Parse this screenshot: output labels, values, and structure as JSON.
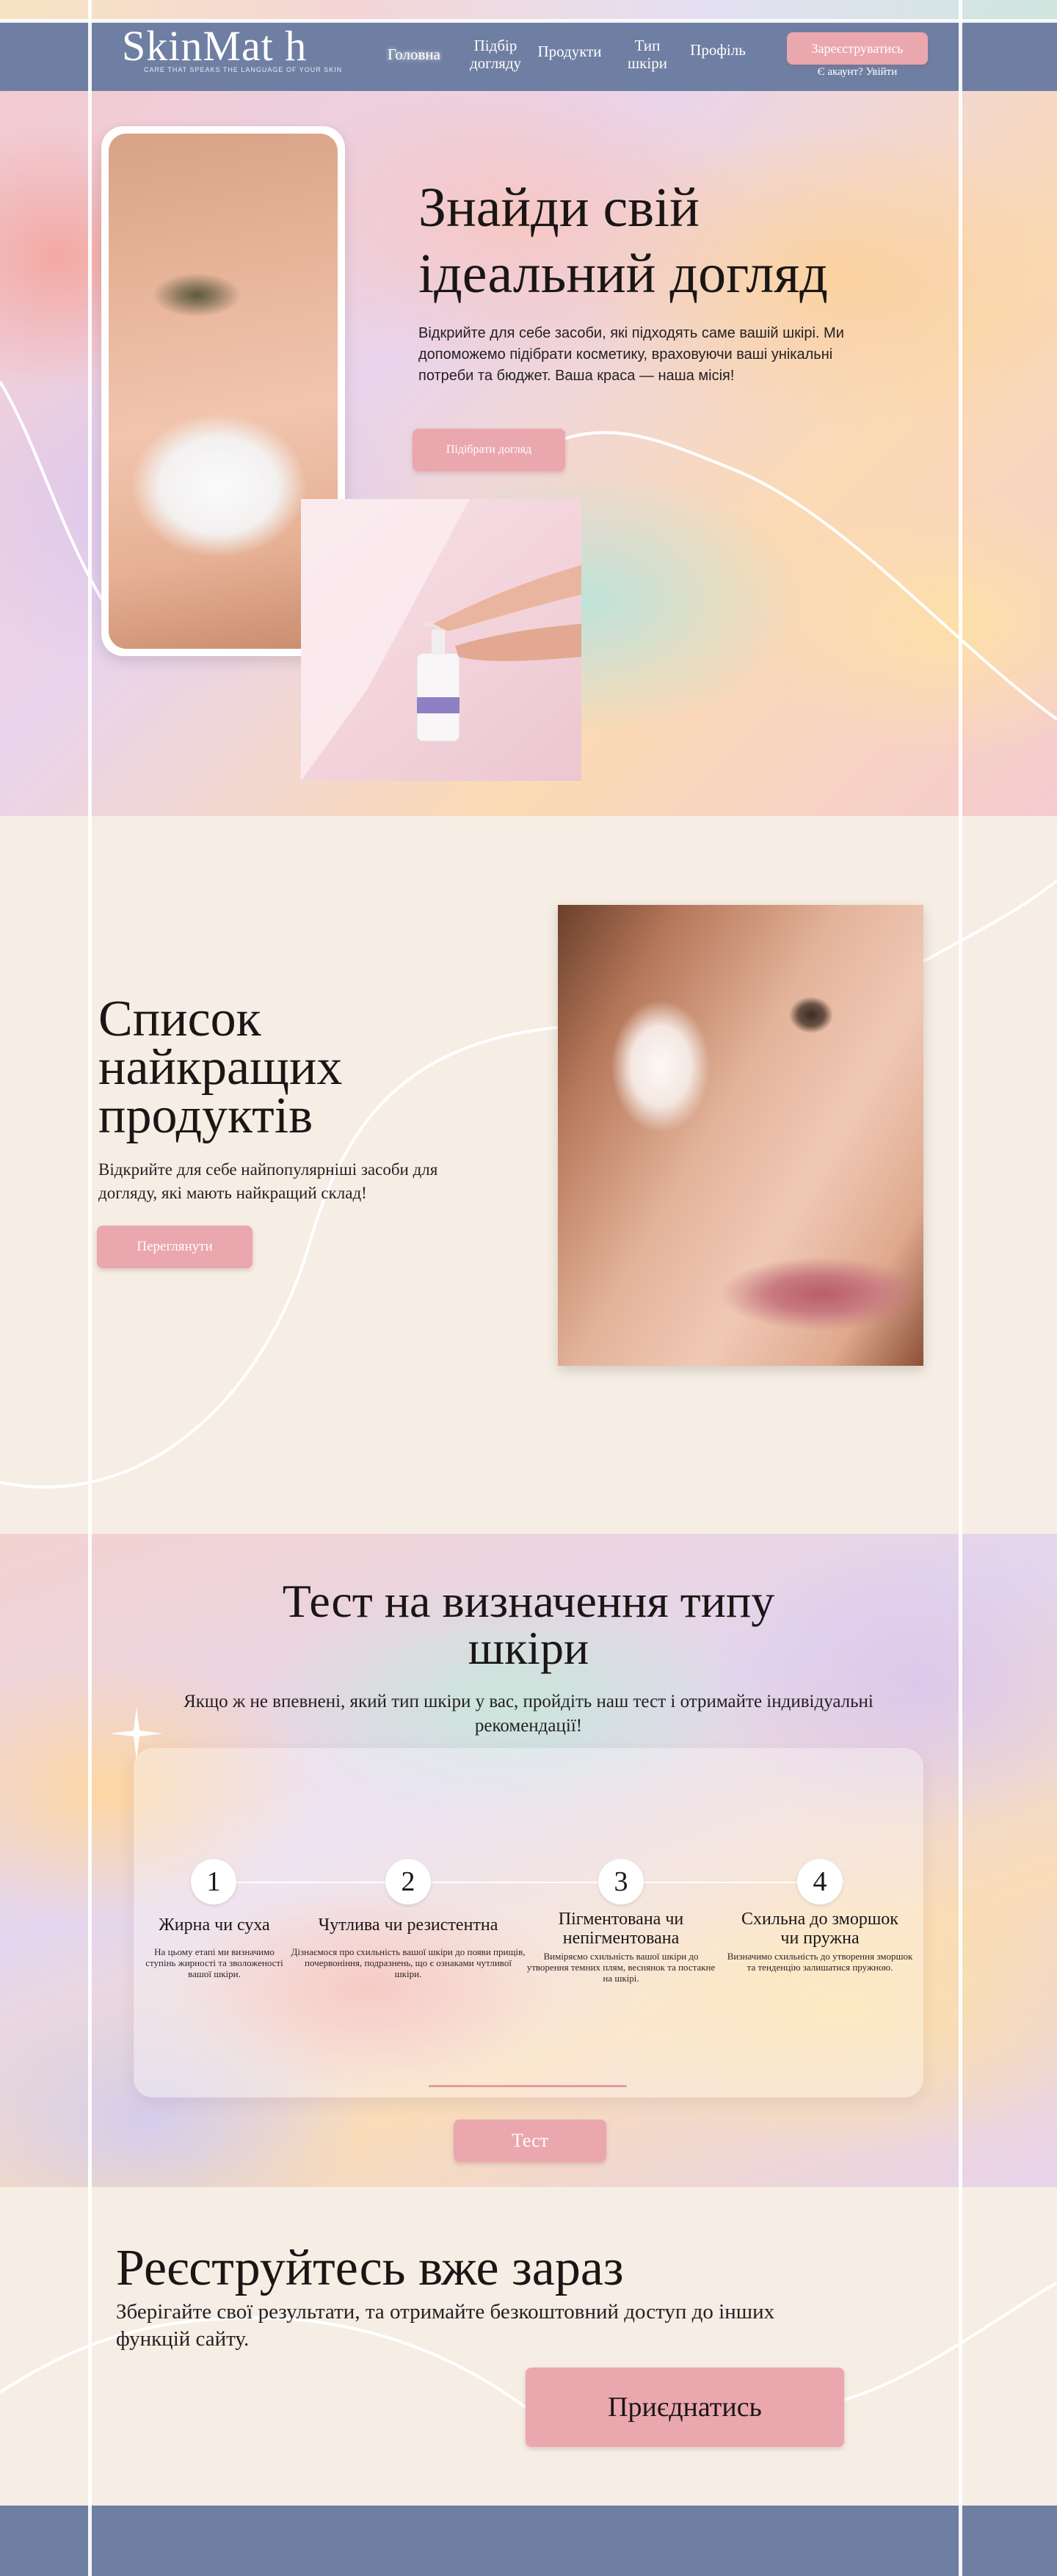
{
  "nav": {
    "logo": "SkinMat  h",
    "tagline": "CARE THAT SPEAKS THE LANGUAGE OF YOUR SKIN",
    "items": [
      {
        "label": "Головна",
        "active": true
      },
      {
        "label": "Підбір догляду"
      },
      {
        "label": "Продукти"
      },
      {
        "label": "Тип шкіри"
      },
      {
        "label": "Профіль"
      }
    ],
    "register_label": "Зареєструватись",
    "login_text": "Є акаунт? Увійти"
  },
  "hero": {
    "title": "Знайди свій ідеальний догляд",
    "subtitle": "Відкрийте для себе засоби, які підходять саме вашій шкірі. Ми допоможемо підібрати косметику, враховуючи ваші унікальні потреби та бюджет. Ваша краса — наша місія!",
    "button_label": "Підібрати догляд"
  },
  "products": {
    "title": "Список найкращих продуктів",
    "subtitle": "Відкрийте для себе найпопулярніші засоби для догляду, які мають найкращий склад!",
    "button_label": "Переглянути"
  },
  "test": {
    "title": "Тест на визначення типу шкіри",
    "subtitle": "Якщо ж не впевнені, який тип шкіри у вас, пройдіть наш тест і отримайте індивідуальні рекомендації!",
    "steps": [
      {
        "number": "1",
        "title": "Жирна чи суха",
        "desc": "На цьому етапі ми визначимо ступінь жирності та зволоженості вашої шкіри."
      },
      {
        "number": "2",
        "title": "Чутлива чи резистентна",
        "desc": "Дізнаємося про схильність вашої шкіри до появи прищів, почервоніння, подразнень, що є ознаками чутливої шкіри."
      },
      {
        "number": "3",
        "title": "Пігментована чи непігментована",
        "desc": "Виміряємо схильність вашої шкіри до утворення темних плям, веснянок та постакне на шкірі."
      },
      {
        "number": "4",
        "title": "Схильна до зморшок чи пружна",
        "desc": "Визначимо схильність до утворення зморшок та тенденцію залишатися пружною."
      }
    ],
    "button_label": "Тест"
  },
  "register": {
    "title": "Реєструйтесь вже зараз",
    "subtitle": "Зберігайте свої результати, та отримайте безкоштовний доступ до інших функцій сайту.",
    "button_label": "Приєднатись"
  },
  "colors": {
    "nav_bg": "#6f7fa3",
    "accent_pink": "#eba7ae",
    "cream": "#f6ede4"
  }
}
